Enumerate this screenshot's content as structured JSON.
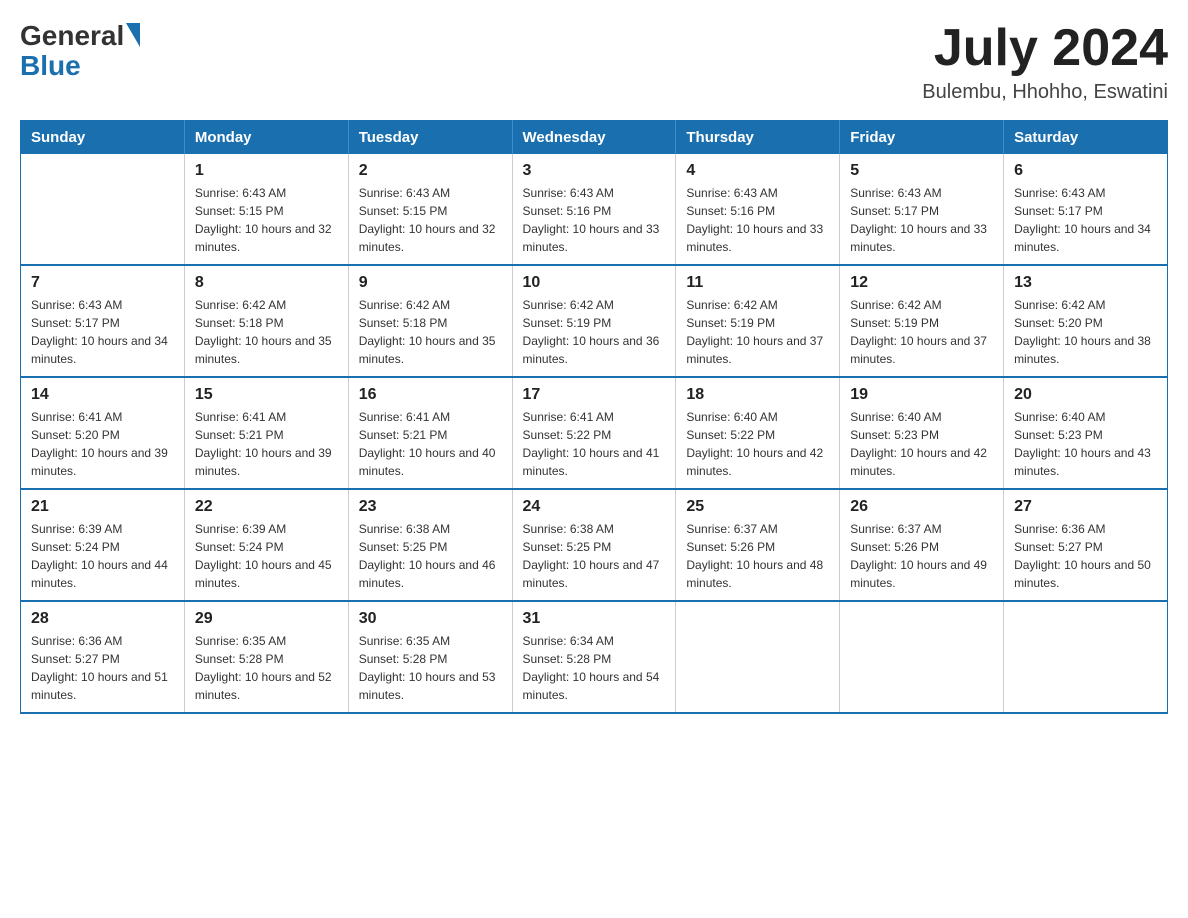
{
  "header": {
    "logo_general": "General",
    "logo_blue": "Blue",
    "month_year": "July 2024",
    "location": "Bulembu, Hhohho, Eswatini"
  },
  "days_of_week": [
    "Sunday",
    "Monday",
    "Tuesday",
    "Wednesday",
    "Thursday",
    "Friday",
    "Saturday"
  ],
  "weeks": [
    [
      {
        "day": "",
        "sunrise": "",
        "sunset": "",
        "daylight": ""
      },
      {
        "day": "1",
        "sunrise": "Sunrise: 6:43 AM",
        "sunset": "Sunset: 5:15 PM",
        "daylight": "Daylight: 10 hours and 32 minutes."
      },
      {
        "day": "2",
        "sunrise": "Sunrise: 6:43 AM",
        "sunset": "Sunset: 5:15 PM",
        "daylight": "Daylight: 10 hours and 32 minutes."
      },
      {
        "day": "3",
        "sunrise": "Sunrise: 6:43 AM",
        "sunset": "Sunset: 5:16 PM",
        "daylight": "Daylight: 10 hours and 33 minutes."
      },
      {
        "day": "4",
        "sunrise": "Sunrise: 6:43 AM",
        "sunset": "Sunset: 5:16 PM",
        "daylight": "Daylight: 10 hours and 33 minutes."
      },
      {
        "day": "5",
        "sunrise": "Sunrise: 6:43 AM",
        "sunset": "Sunset: 5:17 PM",
        "daylight": "Daylight: 10 hours and 33 minutes."
      },
      {
        "day": "6",
        "sunrise": "Sunrise: 6:43 AM",
        "sunset": "Sunset: 5:17 PM",
        "daylight": "Daylight: 10 hours and 34 minutes."
      }
    ],
    [
      {
        "day": "7",
        "sunrise": "Sunrise: 6:43 AM",
        "sunset": "Sunset: 5:17 PM",
        "daylight": "Daylight: 10 hours and 34 minutes."
      },
      {
        "day": "8",
        "sunrise": "Sunrise: 6:42 AM",
        "sunset": "Sunset: 5:18 PM",
        "daylight": "Daylight: 10 hours and 35 minutes."
      },
      {
        "day": "9",
        "sunrise": "Sunrise: 6:42 AM",
        "sunset": "Sunset: 5:18 PM",
        "daylight": "Daylight: 10 hours and 35 minutes."
      },
      {
        "day": "10",
        "sunrise": "Sunrise: 6:42 AM",
        "sunset": "Sunset: 5:19 PM",
        "daylight": "Daylight: 10 hours and 36 minutes."
      },
      {
        "day": "11",
        "sunrise": "Sunrise: 6:42 AM",
        "sunset": "Sunset: 5:19 PM",
        "daylight": "Daylight: 10 hours and 37 minutes."
      },
      {
        "day": "12",
        "sunrise": "Sunrise: 6:42 AM",
        "sunset": "Sunset: 5:19 PM",
        "daylight": "Daylight: 10 hours and 37 minutes."
      },
      {
        "day": "13",
        "sunrise": "Sunrise: 6:42 AM",
        "sunset": "Sunset: 5:20 PM",
        "daylight": "Daylight: 10 hours and 38 minutes."
      }
    ],
    [
      {
        "day": "14",
        "sunrise": "Sunrise: 6:41 AM",
        "sunset": "Sunset: 5:20 PM",
        "daylight": "Daylight: 10 hours and 39 minutes."
      },
      {
        "day": "15",
        "sunrise": "Sunrise: 6:41 AM",
        "sunset": "Sunset: 5:21 PM",
        "daylight": "Daylight: 10 hours and 39 minutes."
      },
      {
        "day": "16",
        "sunrise": "Sunrise: 6:41 AM",
        "sunset": "Sunset: 5:21 PM",
        "daylight": "Daylight: 10 hours and 40 minutes."
      },
      {
        "day": "17",
        "sunrise": "Sunrise: 6:41 AM",
        "sunset": "Sunset: 5:22 PM",
        "daylight": "Daylight: 10 hours and 41 minutes."
      },
      {
        "day": "18",
        "sunrise": "Sunrise: 6:40 AM",
        "sunset": "Sunset: 5:22 PM",
        "daylight": "Daylight: 10 hours and 42 minutes."
      },
      {
        "day": "19",
        "sunrise": "Sunrise: 6:40 AM",
        "sunset": "Sunset: 5:23 PM",
        "daylight": "Daylight: 10 hours and 42 minutes."
      },
      {
        "day": "20",
        "sunrise": "Sunrise: 6:40 AM",
        "sunset": "Sunset: 5:23 PM",
        "daylight": "Daylight: 10 hours and 43 minutes."
      }
    ],
    [
      {
        "day": "21",
        "sunrise": "Sunrise: 6:39 AM",
        "sunset": "Sunset: 5:24 PM",
        "daylight": "Daylight: 10 hours and 44 minutes."
      },
      {
        "day": "22",
        "sunrise": "Sunrise: 6:39 AM",
        "sunset": "Sunset: 5:24 PM",
        "daylight": "Daylight: 10 hours and 45 minutes."
      },
      {
        "day": "23",
        "sunrise": "Sunrise: 6:38 AM",
        "sunset": "Sunset: 5:25 PM",
        "daylight": "Daylight: 10 hours and 46 minutes."
      },
      {
        "day": "24",
        "sunrise": "Sunrise: 6:38 AM",
        "sunset": "Sunset: 5:25 PM",
        "daylight": "Daylight: 10 hours and 47 minutes."
      },
      {
        "day": "25",
        "sunrise": "Sunrise: 6:37 AM",
        "sunset": "Sunset: 5:26 PM",
        "daylight": "Daylight: 10 hours and 48 minutes."
      },
      {
        "day": "26",
        "sunrise": "Sunrise: 6:37 AM",
        "sunset": "Sunset: 5:26 PM",
        "daylight": "Daylight: 10 hours and 49 minutes."
      },
      {
        "day": "27",
        "sunrise": "Sunrise: 6:36 AM",
        "sunset": "Sunset: 5:27 PM",
        "daylight": "Daylight: 10 hours and 50 minutes."
      }
    ],
    [
      {
        "day": "28",
        "sunrise": "Sunrise: 6:36 AM",
        "sunset": "Sunset: 5:27 PM",
        "daylight": "Daylight: 10 hours and 51 minutes."
      },
      {
        "day": "29",
        "sunrise": "Sunrise: 6:35 AM",
        "sunset": "Sunset: 5:28 PM",
        "daylight": "Daylight: 10 hours and 52 minutes."
      },
      {
        "day": "30",
        "sunrise": "Sunrise: 6:35 AM",
        "sunset": "Sunset: 5:28 PM",
        "daylight": "Daylight: 10 hours and 53 minutes."
      },
      {
        "day": "31",
        "sunrise": "Sunrise: 6:34 AM",
        "sunset": "Sunset: 5:28 PM",
        "daylight": "Daylight: 10 hours and 54 minutes."
      },
      {
        "day": "",
        "sunrise": "",
        "sunset": "",
        "daylight": ""
      },
      {
        "day": "",
        "sunrise": "",
        "sunset": "",
        "daylight": ""
      },
      {
        "day": "",
        "sunrise": "",
        "sunset": "",
        "daylight": ""
      }
    ]
  ]
}
